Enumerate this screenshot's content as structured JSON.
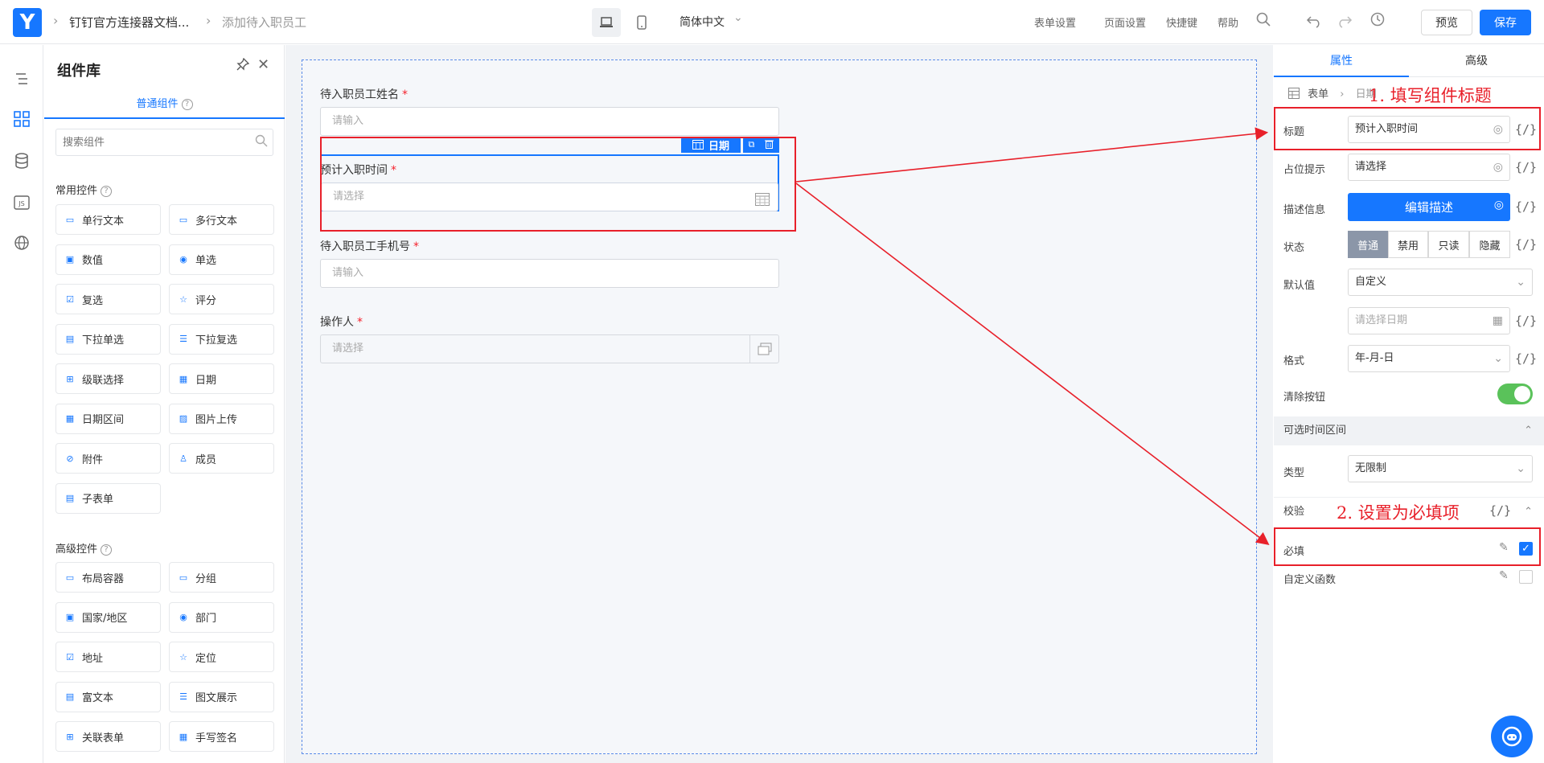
{
  "topbar": {
    "logo": "Y",
    "breadcrumb": [
      "钉钉官方连接器文档...",
      "添加待入职员工"
    ],
    "language": "简体中文",
    "links": [
      "表单设置",
      "页面设置",
      "快捷键",
      "帮助"
    ],
    "preview": "预览",
    "save": "保存"
  },
  "panel": {
    "title": "组件库",
    "tab": "普通组件",
    "search_placeholder": "搜索组件",
    "common_title": "常用控件",
    "common": [
      "单行文本",
      "多行文本",
      "数值",
      "单选",
      "复选",
      "评分",
      "下拉单选",
      "下拉复选",
      "级联选择",
      "日期",
      "日期区间",
      "图片上传",
      "附件",
      "成员",
      "子表单"
    ],
    "advanced_title": "高级控件",
    "advanced": [
      "布局容器",
      "分组",
      "国家/地区",
      "部门",
      "地址",
      "定位",
      "富文本",
      "图文展示",
      "关联表单",
      "手写签名"
    ]
  },
  "form": {
    "fields": [
      {
        "label": "待入职员工姓名",
        "placeholder": "请输入"
      },
      {
        "label": "预计入职时间",
        "placeholder": "请选择"
      },
      {
        "label": "待入职员工手机号",
        "placeholder": "请输入"
      },
      {
        "label": "操作人",
        "placeholder": "请选择"
      }
    ],
    "required_mark": "*",
    "selected_badge": "日期"
  },
  "annotations": {
    "step1": "1. 填写组件标题",
    "step2": "2. 设置为必填项"
  },
  "props": {
    "tab_props": "属性",
    "tab_advanced": "高级",
    "crumb_form": "表单",
    "crumb_date": "日期",
    "title_label": "标题",
    "title_value": "预计入职时间",
    "placeholder_label": "占位提示",
    "placeholder_value": "请选择",
    "desc_label": "描述信息",
    "desc_button": "编辑描述",
    "state_label": "状态",
    "states": [
      "普通",
      "禁用",
      "只读",
      "隐藏"
    ],
    "default_label": "默认值",
    "default_value": "自定义",
    "date_placeholder": "请选择日期",
    "format_label": "格式",
    "format_value": "年-月-日",
    "clear_label": "清除按钮",
    "range_group": "可选时间区间",
    "type_label": "类型",
    "type_value": "无限制",
    "validation_group": "校验",
    "required_label": "必填",
    "custom_fn_label": "自定义函数",
    "fx": "{/}"
  },
  "colors": {
    "accent": "#1677ff",
    "annotation": "#e8202a",
    "toggle_on": "#5ac25a"
  }
}
